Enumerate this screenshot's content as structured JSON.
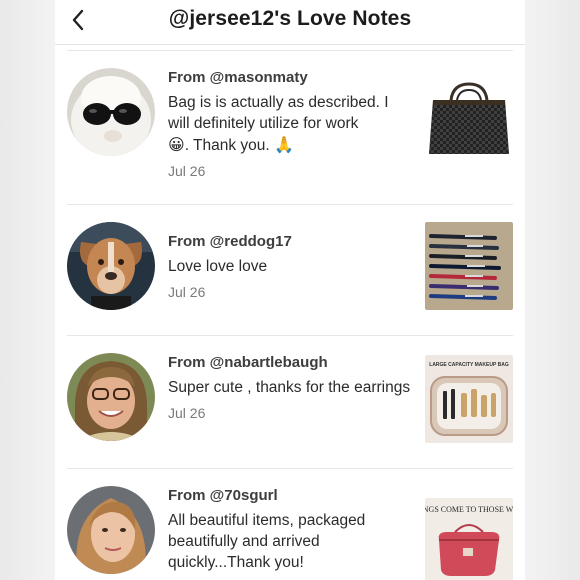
{
  "header": {
    "title": "@jersee12's Love Notes"
  },
  "notes": [
    {
      "from": "From @masonmaty",
      "message_part1": "Bag is is actually as described. I will definitely utilize for work",
      "emoji1": "😀",
      "message_part2": ". Thank you. ",
      "emoji2": "🙏",
      "date": "Jul 26"
    },
    {
      "from": "From @reddog17",
      "message": "Love love love",
      "date": "Jul 26"
    },
    {
      "from": "From @nabartlebaugh",
      "message": "Super cute , thanks for the earrings",
      "date": "Jul 26",
      "thumb_text": "LARGE CAPACITY MAKEUP BAG"
    },
    {
      "from": "From @70sgurl",
      "message": "All beautiful items, packaged beautifully and arrived quickly...Thank you!",
      "thumb_text": "GOOD THINGS COME TO THOSE WHO HUSTLE"
    }
  ],
  "colors": {
    "accent_dark": "#1c1c1c",
    "divider": "#e7e7e7",
    "date_gray": "#7a7a7a"
  }
}
